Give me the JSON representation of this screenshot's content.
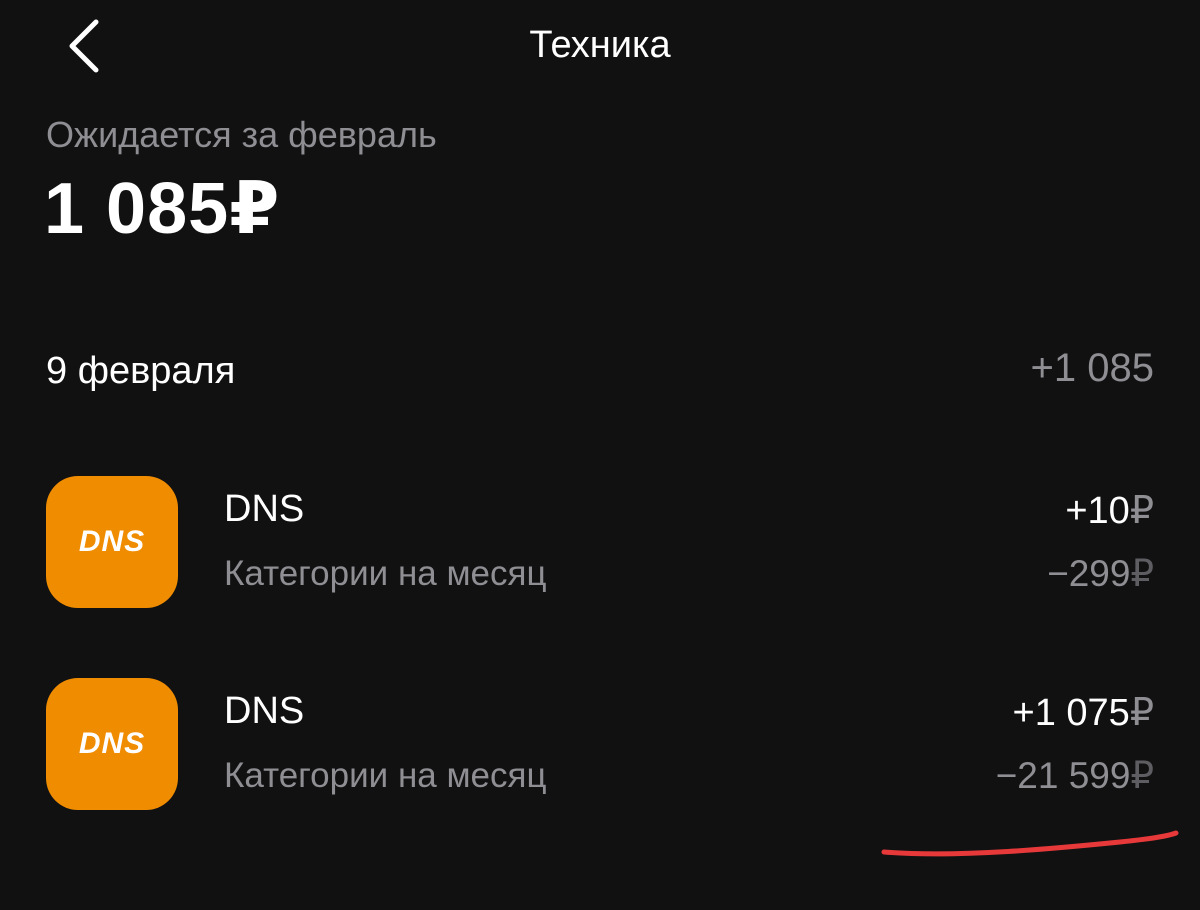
{
  "header": {
    "title": "Техника",
    "back_icon": "chevron-left-icon"
  },
  "summary": {
    "label": "Ожидается за февраль",
    "amount": "1 085",
    "currency": "₽"
  },
  "group": {
    "date": "9 февраля",
    "total": "+1 085"
  },
  "operations": [
    {
      "logo_text": "DNS",
      "name": "DNS",
      "category": "Категории на месяц",
      "amount": "+10",
      "currency": "₽",
      "cashback": "−299",
      "cashback_currency": "₽"
    },
    {
      "logo_text": "DNS",
      "name": "DNS",
      "category": "Категории на месяц",
      "amount": "+1 075",
      "currency": "₽",
      "cashback": "−21 599",
      "cashback_currency": "₽"
    }
  ],
  "colors": {
    "background": "#111112",
    "text_secondary": "#8e8e93",
    "brand_orange": "#f08c00",
    "annotation_red": "#e8393a"
  }
}
